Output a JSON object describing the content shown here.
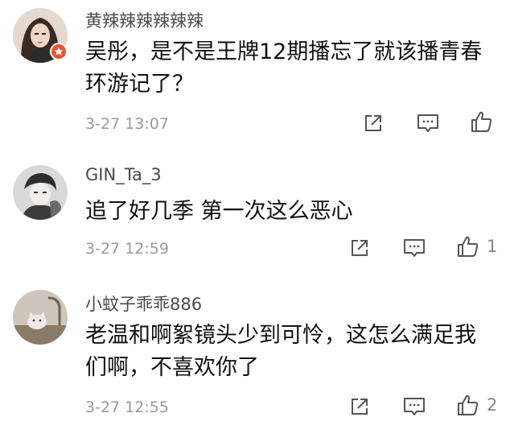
{
  "comments": [
    {
      "username": "黄辣辣辣辣辣辣",
      "content": "吴彤，是不是王牌12期播忘了就该播青春环游记了？",
      "time": "3-27 13:07",
      "likes": "",
      "avatar_icon": "user-avatar-woman",
      "badge_icon": "verified-badge-icon",
      "badge_color": "#e8542f"
    },
    {
      "username": "GIN_Ta_3",
      "content": "追了好几季 第一次这么恶心",
      "time": "3-27 12:59",
      "likes": "1",
      "avatar_icon": "user-avatar-illustration"
    },
    {
      "username": "小蚊子乖乖886",
      "content": "老温和啊絮镜头少到可怜，这怎么满足我们啊，不喜欢你了",
      "time": "3-27 12:55",
      "likes": "2",
      "avatar_icon": "user-avatar-cat"
    }
  ],
  "actions": {
    "share_icon": "share-icon",
    "reply_icon": "reply-icon",
    "like_icon": "thumbs-up-icon"
  }
}
